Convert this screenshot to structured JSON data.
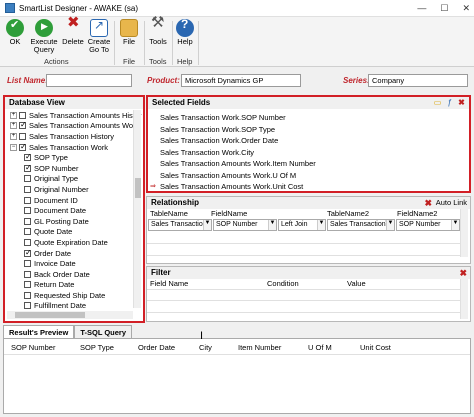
{
  "window": {
    "title": "SmartList Designer  -  AWAKE (sa)",
    "controls": [
      "—",
      "☐",
      "✕"
    ]
  },
  "ribbon": {
    "ok": "OK",
    "execute": "Execute Query",
    "delete": "Delete",
    "goto": "Create Go To",
    "file": "File",
    "tools": "Tools",
    "help": "Help",
    "group_actions": "Actions",
    "group_file": "File",
    "group_tools": "Tools",
    "group_help": "Help"
  },
  "filters": {
    "list_name_label": "List Name:",
    "list_name_value": "",
    "product_label": "Product:",
    "product_value": "Microsoft Dynamics GP",
    "series_label": "Series:",
    "series_value": "Company"
  },
  "database_view": {
    "title": "Database View",
    "items": [
      {
        "label": "Sales Transaction Amounts Histor",
        "level": 0,
        "exp": "+",
        "checked": false
      },
      {
        "label": "Sales Transaction Amounts Work",
        "level": 0,
        "exp": "+",
        "checked": true
      },
      {
        "label": "Sales Transaction History",
        "level": 0,
        "exp": "+",
        "checked": false
      },
      {
        "label": "Sales Transaction Work",
        "level": 0,
        "exp": "−",
        "checked": true
      },
      {
        "label": "SOP Type",
        "level": 1,
        "checked": true
      },
      {
        "label": "SOP Number",
        "level": 1,
        "checked": true
      },
      {
        "label": "Original Type",
        "level": 1,
        "checked": false
      },
      {
        "label": "Original Number",
        "level": 1,
        "checked": false
      },
      {
        "label": "Document ID",
        "level": 1,
        "checked": false
      },
      {
        "label": "Document Date",
        "level": 1,
        "checked": false
      },
      {
        "label": "GL Posting Date",
        "level": 1,
        "checked": false
      },
      {
        "label": "Quote Date",
        "level": 1,
        "checked": false
      },
      {
        "label": "Quote Expiration Date",
        "level": 1,
        "checked": false
      },
      {
        "label": "Order Date",
        "level": 1,
        "checked": true
      },
      {
        "label": "Invoice Date",
        "level": 1,
        "checked": false
      },
      {
        "label": "Back Order Date",
        "level": 1,
        "checked": false
      },
      {
        "label": "Return Date",
        "level": 1,
        "checked": false
      },
      {
        "label": "Requested Ship Date",
        "level": 1,
        "checked": false
      },
      {
        "label": "Fulfillment Date",
        "level": 1,
        "checked": false
      }
    ]
  },
  "selected_fields": {
    "title": "Selected Fields",
    "items": [
      "Sales Transaction Work.SOP Number",
      "Sales Transaction Work.SOP Type",
      "Sales Transaction Work.Order Date",
      "Sales Transaction Work.City",
      "Sales Transaction Amounts Work.Item Number",
      "Sales Transaction Amounts Work.U Of M",
      "Sales Transaction Amounts Work.Unit Cost"
    ],
    "marker": "⇒"
  },
  "relationship": {
    "title": "Relationship",
    "autolink": "Auto Link",
    "columns": [
      "TableName",
      "FieldName",
      "",
      "TableName2",
      "FieldName2"
    ],
    "row": [
      "Sales Transaction\\",
      "SOP Number",
      "Left Join",
      "Sales Transaction\\",
      "SOP Number"
    ]
  },
  "filter": {
    "title": "Filter",
    "columns": [
      "Field Name",
      "Condition",
      "Value"
    ]
  },
  "tabs": [
    "Result's Preview",
    "T-SQL Query"
  ],
  "results": {
    "columns": [
      "SOP Number",
      "SOP Type",
      "Order Date",
      "City",
      "Item Number",
      "U Of M",
      "Unit Cost"
    ]
  }
}
